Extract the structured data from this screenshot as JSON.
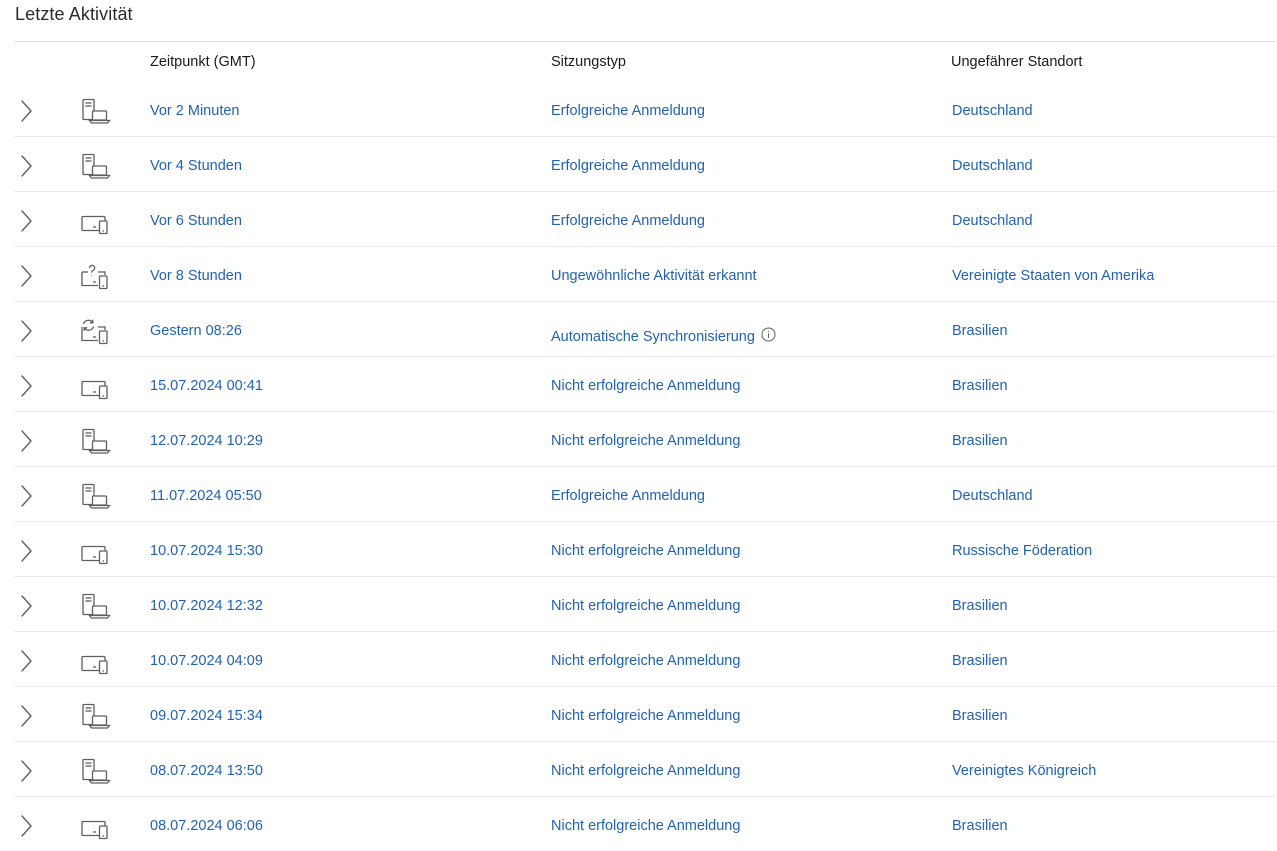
{
  "page": {
    "title": "Letzte Aktivität"
  },
  "table": {
    "headers": {
      "time": "Zeitpunkt (GMT)",
      "type": "Sitzungstyp",
      "location": "Ungefährer Standort"
    },
    "rows": [
      {
        "icon": "desktop-laptop-icon",
        "time": "Vor 2 Minuten",
        "type": "Erfolgreiche Anmeldung",
        "location": "Deutschland",
        "info": false
      },
      {
        "icon": "desktop-laptop-icon",
        "time": "Vor 4 Stunden",
        "type": "Erfolgreiche Anmeldung",
        "location": "Deutschland",
        "info": false
      },
      {
        "icon": "monitor-phone-icon",
        "time": "Vor 6 Stunden",
        "type": "Erfolgreiche Anmeldung",
        "location": "Deutschland",
        "info": false
      },
      {
        "icon": "unknown-device-icon",
        "time": "Vor 8 Stunden",
        "type": "Ungewöhnliche Aktivität erkannt",
        "location": "Vereinigte Staaten von Amerika",
        "info": false
      },
      {
        "icon": "sync-device-icon",
        "time": "Gestern 08:26",
        "type": "Automatische Synchronisierung",
        "location": "Brasilien",
        "info": true
      },
      {
        "icon": "monitor-phone-icon",
        "time": "15.07.2024 00:41",
        "type": "Nicht erfolgreiche Anmeldung",
        "location": "Brasilien",
        "info": false
      },
      {
        "icon": "desktop-laptop-icon",
        "time": "12.07.2024 10:29",
        "type": "Nicht erfolgreiche Anmeldung",
        "location": "Brasilien",
        "info": false
      },
      {
        "icon": "desktop-laptop-icon",
        "time": "11.07.2024 05:50",
        "type": "Erfolgreiche Anmeldung",
        "location": "Deutschland",
        "info": false
      },
      {
        "icon": "monitor-phone-icon",
        "time": "10.07.2024 15:30",
        "type": "Nicht erfolgreiche Anmeldung",
        "location": "Russische Föderation",
        "info": false
      },
      {
        "icon": "desktop-laptop-icon",
        "time": "10.07.2024 12:32",
        "type": "Nicht erfolgreiche Anmeldung",
        "location": "Brasilien",
        "info": false
      },
      {
        "icon": "monitor-phone-icon",
        "time": "10.07.2024 04:09",
        "type": "Nicht erfolgreiche Anmeldung",
        "location": "Brasilien",
        "info": false
      },
      {
        "icon": "desktop-laptop-icon",
        "time": "09.07.2024 15:34",
        "type": "Nicht erfolgreiche Anmeldung",
        "location": "Brasilien",
        "info": false
      },
      {
        "icon": "desktop-laptop-icon",
        "time": "08.07.2024 13:50",
        "type": "Nicht erfolgreiche Anmeldung",
        "location": "Vereinigtes Königreich",
        "info": false
      },
      {
        "icon": "monitor-phone-icon",
        "time": "08.07.2024 06:06",
        "type": "Nicht erfolgreiche Anmeldung",
        "location": "Brasilien",
        "info": false
      }
    ]
  },
  "colors": {
    "link": "#2262b0",
    "icon": "#5f5f5f",
    "divider": "#ebebeb"
  }
}
